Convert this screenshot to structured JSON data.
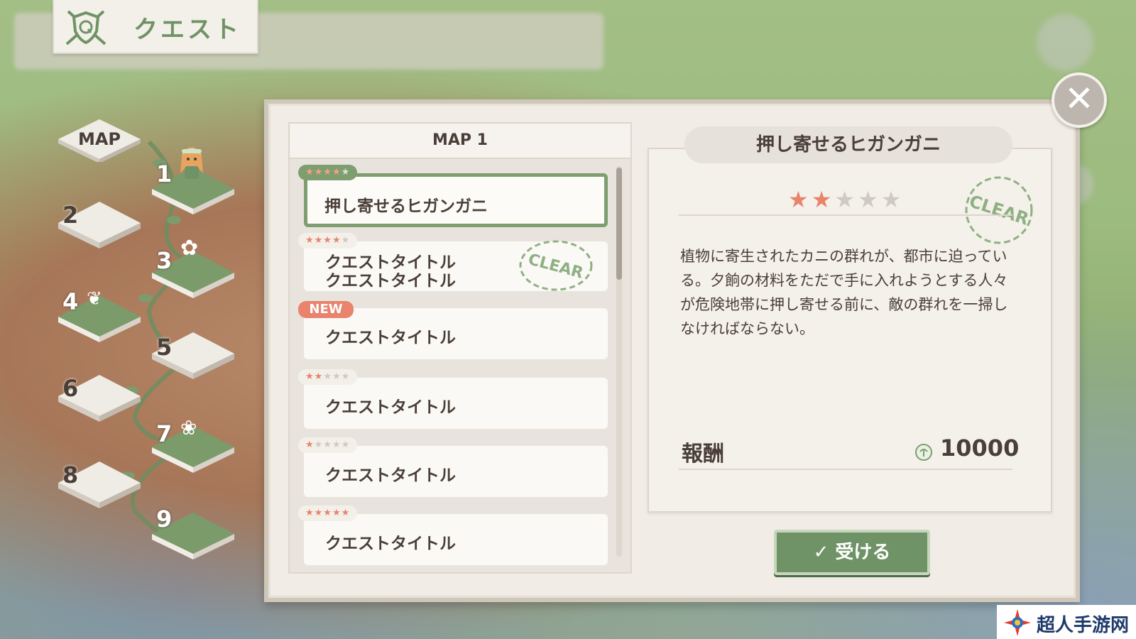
{
  "header": {
    "title": "クエスト",
    "icon": "quest-shield-icon"
  },
  "map_nav": {
    "label": "MAP",
    "tiles": [
      {
        "num": "1",
        "state": "cleared",
        "icon": "character-icon"
      },
      {
        "num": "2",
        "state": "locked"
      },
      {
        "num": "3",
        "state": "cleared",
        "icon": "flower-icon"
      },
      {
        "num": "4",
        "state": "cleared",
        "icon": "sprout-icon"
      },
      {
        "num": "5",
        "state": "locked"
      },
      {
        "num": "6",
        "state": "locked"
      },
      {
        "num": "7",
        "state": "cleared",
        "icon": "plant-icon"
      },
      {
        "num": "8",
        "state": "locked"
      },
      {
        "num": "9",
        "state": "cleared"
      }
    ]
  },
  "quest_list": {
    "header": "MAP 1",
    "items": [
      {
        "title": "押し寄せるヒガンガニ",
        "stars": 4,
        "selected": true
      },
      {
        "title_line1": "クエストタイトル",
        "title_line2": "クエストタイトル",
        "stars": 4,
        "clear": true
      },
      {
        "title": "クエストタイトル",
        "badge": "NEW"
      },
      {
        "title": "クエストタイトル",
        "stars": 2
      },
      {
        "title": "クエストタイトル",
        "stars": 1
      },
      {
        "title": "クエストタイトル",
        "stars": 5
      }
    ]
  },
  "detail": {
    "title": "押し寄せるヒガンガニ",
    "stars": 2,
    "max_stars": 5,
    "stamp": "CLEAR",
    "description": "植物に寄生されたカニの群れが、都市に迫っている。夕餉の材料をただで手に入れようとする人々が危険地帯に押し寄せる前に、敵の群れを一掃しなければならない。",
    "reward_label": "報酬",
    "reward_value": "10000",
    "reward_icon": "coin-icon",
    "accept_label": "✓ 受ける"
  },
  "close_label": "✕",
  "watermark": "超人手游网",
  "colors": {
    "accent_green": "#6f9366",
    "star_on": "#e9836b",
    "panel_bg": "#f1ede6"
  }
}
